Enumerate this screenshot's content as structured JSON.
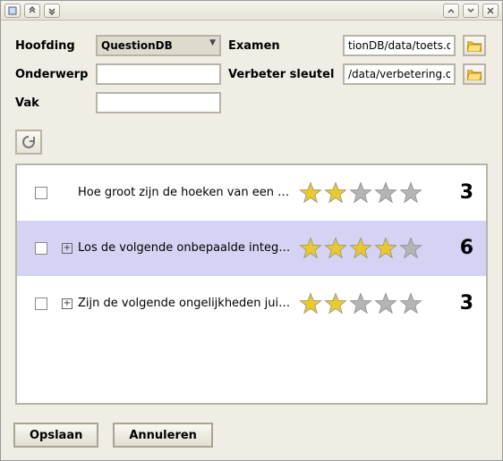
{
  "titlebar": {
    "app_icon": "app-icon",
    "expand_up": "«",
    "expand_down": "»"
  },
  "form": {
    "hoofding_label": "Hoofding",
    "hoofding_value": "QuestionDB",
    "onderwerp_label": "Onderwerp",
    "onderwerp_value": "",
    "vak_label": "Vak",
    "vak_value": "",
    "examen_label": "Examen",
    "examen_value": "tionDB/data/toets.odt",
    "verbeter_label": "Verbeter sleutel",
    "verbeter_value": "/data/verbetering.odt"
  },
  "rows": [
    {
      "expandable": false,
      "text": "Hoe groot zijn de hoeken van een recht...",
      "stars": 2,
      "score": "3",
      "selected": false
    },
    {
      "expandable": true,
      "text": "Los de volgende onbepaalde integralen ...",
      "stars": 4,
      "score": "6",
      "selected": true
    },
    {
      "expandable": true,
      "text": "Zijn de volgende ongelijkheden juist of f...",
      "stars": 2,
      "score": "3",
      "selected": false
    }
  ],
  "buttons": {
    "save": "Opslaan",
    "cancel": "Annuleren"
  },
  "star_total": 5,
  "colors": {
    "star_on": "#e9c92e",
    "star_off": "#b4b4b4"
  }
}
